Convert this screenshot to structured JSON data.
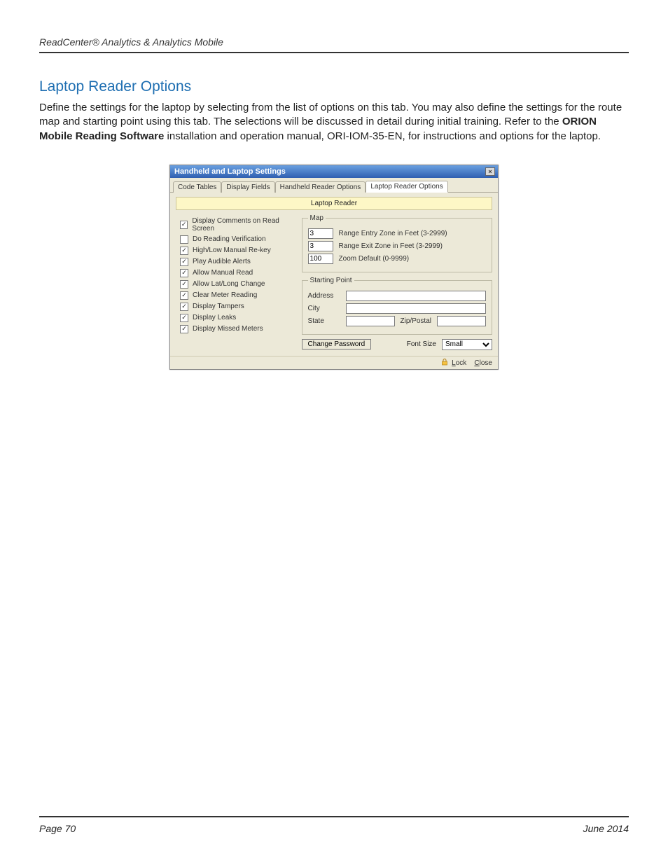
{
  "header": {
    "running_head": "ReadCenter® Analytics & Analytics Mobile"
  },
  "section": {
    "title": "Laptop Reader Options",
    "para_pre": "Define the settings for the laptop by selecting from the list of options on this tab. You may also define the settings for the route map and starting point using this tab. The selections will be discussed in detail during initial training. Refer to the ",
    "para_bold": "ORION Mobile Reading Software",
    "para_post": " installation and operation manual, ORI-IOM-35-EN, for instructions and options for the laptop."
  },
  "dialog": {
    "title": "Handheld and Laptop Settings",
    "close_glyph": "×",
    "tabs": [
      {
        "label": "Code Tables",
        "active": false
      },
      {
        "label": "Display Fields",
        "active": false
      },
      {
        "label": "Handheld Reader Options",
        "active": false
      },
      {
        "label": "Laptop Reader Options",
        "active": true
      }
    ],
    "panel_header": "Laptop Reader",
    "checkboxes": [
      {
        "label": "Display Comments on Read Screen",
        "checked": true
      },
      {
        "label": "Do Reading Verification",
        "checked": false
      },
      {
        "label": "High/Low Manual Re-key",
        "checked": true
      },
      {
        "label": "Play Audible Alerts",
        "checked": true
      },
      {
        "label": "Allow Manual Read",
        "checked": true
      },
      {
        "label": "Allow Lat/Long Change",
        "checked": true
      },
      {
        "label": "Clear Meter Reading",
        "checked": true
      },
      {
        "label": "Display Tampers",
        "checked": true
      },
      {
        "label": "Display Leaks",
        "checked": true
      },
      {
        "label": "Display Missed Meters",
        "checked": true
      }
    ],
    "map": {
      "legend": "Map",
      "range_entry": {
        "value": "3",
        "label": "Range Entry Zone in Feet (3-2999)"
      },
      "range_exit": {
        "value": "3",
        "label": "Range Exit Zone in Feet (3-2999)"
      },
      "zoom": {
        "value": "100",
        "label": "Zoom Default (0-9999)"
      }
    },
    "start": {
      "legend": "Starting Point",
      "address_label": "Address",
      "city_label": "City",
      "state_label": "State",
      "zip_label": "Zip/Postal",
      "address_value": "",
      "city_value": "",
      "state_value": "",
      "zip_value": ""
    },
    "change_password_label": "Change Password",
    "font_size_label": "Font Size",
    "font_size_value": "Small",
    "footer": {
      "lock_label": "Lock",
      "lock_mnemonic": "L",
      "close_label": "Close",
      "close_mnemonic": "C"
    }
  },
  "page_footer": {
    "left": "Page 70",
    "right": "June 2014"
  }
}
